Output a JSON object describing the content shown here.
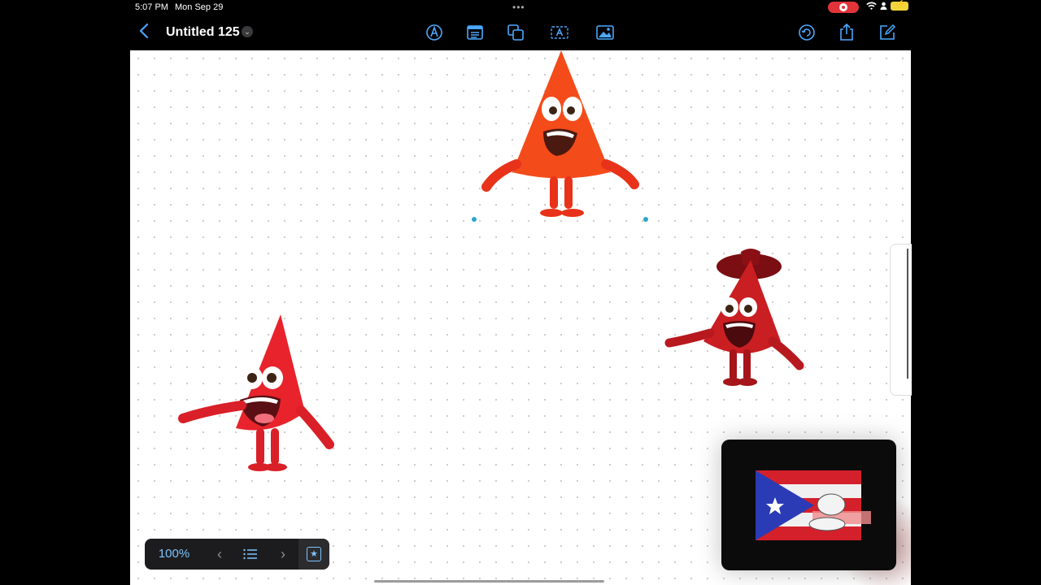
{
  "status_bar": {
    "time": "5:07 PM",
    "date": "Mon Sep 29",
    "more": "•••"
  },
  "toolbar": {
    "title": "Untitled 125",
    "icons": [
      "back-chevron-icon",
      "pen-tool-icon",
      "text-box-icon",
      "shapes-icon",
      "text-frame-icon",
      "media-icon",
      "undo-icon",
      "share-icon",
      "compose-icon"
    ]
  },
  "bottom_bar": {
    "zoom": "100%"
  },
  "stickers": [
    {
      "name": "red-triangle-character",
      "color": "#f44b1a"
    },
    {
      "name": "red-triangle-character",
      "color": "#e8232b"
    },
    {
      "name": "red-triangle-character-with-hat",
      "color": "#c91e22"
    }
  ],
  "pip": {
    "content": "puerto-rico-flag-video"
  },
  "colors": {
    "accent": "#4aa8ff",
    "selection": "#2aa7c9",
    "recording": "#e0343a"
  }
}
